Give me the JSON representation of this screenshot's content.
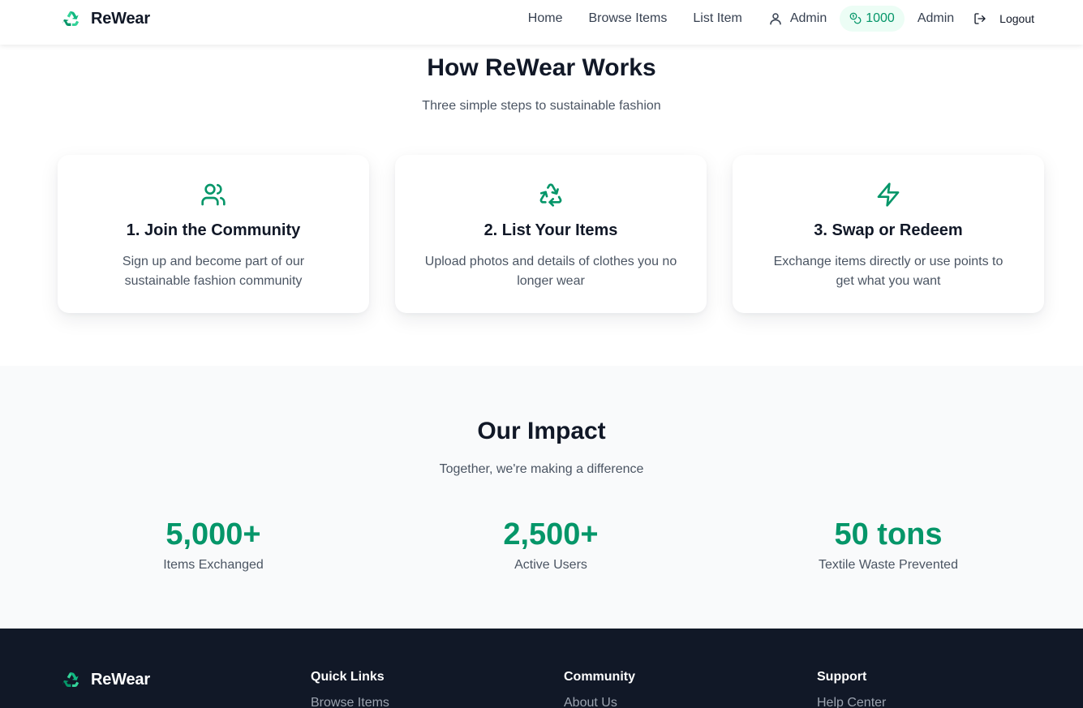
{
  "brand": {
    "name": "ReWear",
    "icon": "recycle-icon",
    "accent": "#059669"
  },
  "nav": {
    "links": [
      "Home",
      "Browse Items",
      "List Item"
    ],
    "user_label": "Admin",
    "points": "1000",
    "admin_label": "Admin",
    "logout_label": "Logout"
  },
  "how": {
    "title": "How ReWear Works",
    "subtitle": "Three simple steps to sustainable fashion",
    "steps": [
      {
        "icon": "users-icon",
        "title": "1. Join the Community",
        "desc": "Sign up and become part of our sustainable fashion community"
      },
      {
        "icon": "recycle-icon",
        "title": "2. List Your Items",
        "desc": "Upload photos and details of clothes you no longer wear"
      },
      {
        "icon": "lightning-icon",
        "title": "3. Swap or Redeem",
        "desc": "Exchange items directly or use points to get what you want"
      }
    ]
  },
  "impact": {
    "title": "Our Impact",
    "subtitle": "Together, we're making a difference",
    "stats": [
      {
        "value": "5,000+",
        "label": "Items Exchanged"
      },
      {
        "value": "2,500+",
        "label": "Active Users"
      },
      {
        "value": "50 tons",
        "label": "Textile Waste Prevented"
      }
    ]
  },
  "footer": {
    "brand_name": "ReWear",
    "columns": [
      {
        "heading": "Quick Links",
        "first_link": "Browse Items"
      },
      {
        "heading": "Community",
        "first_link": "About Us"
      },
      {
        "heading": "Support",
        "first_link": "Help Center"
      }
    ]
  }
}
